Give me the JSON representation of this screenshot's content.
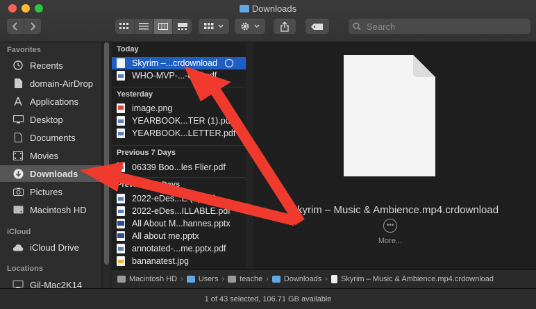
{
  "window": {
    "title": "Downloads",
    "traffic_colors": {
      "close": "#ff5f57",
      "minimize": "#febc2e",
      "zoom": "#28c840"
    }
  },
  "toolbar": {
    "back_icon": "chevron-left-icon",
    "forward_icon": "chevron-right-icon",
    "view_modes": [
      "icon-view-icon",
      "list-view-icon",
      "column-view-icon",
      "gallery-view-icon"
    ],
    "active_view": "column-view-icon",
    "group_icon": "group-grid-icon",
    "action_icon": "gear-icon",
    "share_icon": "share-icon",
    "tag_icon": "tag-icon",
    "search_placeholder": "Search"
  },
  "sidebar": {
    "favorites_heading": "Favorites",
    "favorites": [
      {
        "label": "Recents",
        "icon": "clock-icon"
      },
      {
        "label": "domain-AirDrop",
        "icon": "document-icon"
      },
      {
        "label": "Applications",
        "icon": "applications-icon"
      },
      {
        "label": "Desktop",
        "icon": "desktop-icon"
      },
      {
        "label": "Documents",
        "icon": "document-icon"
      },
      {
        "label": "Movies",
        "icon": "film-icon"
      },
      {
        "label": "Downloads",
        "icon": "download-icon",
        "selected": true
      },
      {
        "label": "Pictures",
        "icon": "camera-icon"
      },
      {
        "label": "Macintosh HD",
        "icon": "hard-drive-icon"
      }
    ],
    "icloud_heading": "iCloud",
    "icloud": [
      {
        "label": "iCloud Drive",
        "icon": "cloud-icon"
      }
    ],
    "locations_heading": "Locations",
    "locations": [
      {
        "label": "Gil-Mac2K14",
        "icon": "computer-icon"
      }
    ]
  },
  "file_column": {
    "groups": [
      {
        "heading": "Today",
        "files": [
          {
            "name": "Skyrim –...crdownload",
            "type": "doc",
            "selected": true,
            "downloading": true
          },
          {
            "name": "WHO-MVP-...-eng.pdf",
            "type": "pdf"
          }
        ]
      },
      {
        "heading": "Yesterday",
        "files": [
          {
            "name": "image.png",
            "type": "png"
          },
          {
            "name": "YEARBOOK...TER (1).pdf",
            "type": "pdf"
          },
          {
            "name": "YEARBOOK...LETTER.pdf",
            "type": "pdf"
          }
        ]
      },
      {
        "heading": "Previous 7 Days",
        "files": [
          {
            "name": "06339 Boo...les Flier.pdf",
            "type": "pdf"
          }
        ]
      },
      {
        "heading": "Previous 30 Days",
        "files": [
          {
            "name": "2022-eDes...E (1).pdf",
            "type": "pdf"
          },
          {
            "name": "2022-eDes...ILLABLE.pdf",
            "type": "pdf"
          },
          {
            "name": "All About M...hannes.pptx",
            "type": "pptx"
          },
          {
            "name": "All about me.pptx",
            "type": "pptx"
          },
          {
            "name": "annotated-...me.pptx.pdf",
            "type": "pdf"
          },
          {
            "name": "bananatest.jpg",
            "type": "jpg"
          }
        ]
      }
    ]
  },
  "preview": {
    "filename": "Skyrim – Music & Ambience.mp4.crdownload",
    "more_label": "More..."
  },
  "path_bar": [
    {
      "label": "Macintosh HD",
      "icon": "hard-drive-icon"
    },
    {
      "label": "Users",
      "icon": "folder-icon"
    },
    {
      "label": "teache",
      "icon": "home-icon"
    },
    {
      "label": "Downloads",
      "icon": "folder-icon"
    },
    {
      "label": "Skyrim – Music & Ambience.mp4.crdownload",
      "icon": "document-icon"
    }
  ],
  "status_bar": {
    "text": "1 of 43 selected, 106.71 GB available"
  },
  "annotations": {
    "arrow_color": "#f03a2e"
  }
}
